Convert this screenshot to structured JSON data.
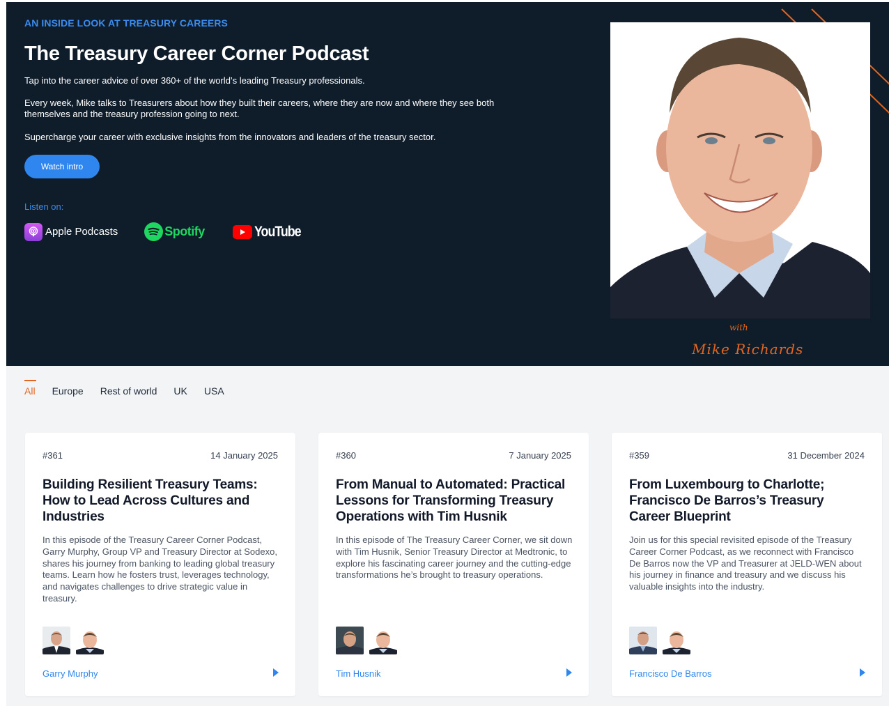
{
  "hero": {
    "eyebrow": "AN INSIDE LOOK AT TREASURY CAREERS",
    "title": "The Treasury Career Corner Podcast",
    "paragraphs": [
      "Tap into the career advice of over 360+ of the world’s leading Treasury professionals.",
      "Every week, Mike talks to Treasurers about how they built their careers, where they are now and where they see both themselves and the treasury profession going to next.",
      "Supercharge your career with exclusive insights from the innovators and leaders of the treasury sector."
    ],
    "watch_button": "Watch intro",
    "listen_label": "Listen on:",
    "platforms": [
      {
        "label": "Apple Podcasts",
        "icon": "apple-podcasts-icon"
      },
      {
        "label": "Spotify",
        "icon": "spotify-icon"
      },
      {
        "label": "YouTube",
        "icon": "youtube-icon"
      }
    ],
    "signature_with": "with",
    "signature_name": "Mike Richards"
  },
  "filters": {
    "items": [
      "All",
      "Europe",
      "Rest of world",
      "UK",
      "USA"
    ],
    "active": "All"
  },
  "episodes": [
    {
      "number": "#361",
      "date": "14 January 2025",
      "title": "Building Resilient Treasury Teams: How to Lead Across Cultures and Industries",
      "description": "In this episode of the Treasury Career Corner Podcast, Garry Murphy, Group VP and Treasury Director at Sodexo, shares his journey from banking to leading global treasury teams. Learn how he fosters trust, leverages technology, and navigates challenges to drive strategic value in treasury.",
      "guest": "Garry Murphy"
    },
    {
      "number": "#360",
      "date": "7 January 2025",
      "title": "From Manual to Automated: Practical Lessons for Transforming Treasury Operations with Tim Husnik",
      "description": "In this episode of The Treasury Career Corner, we sit down with Tim Husnik, Senior Treasury Director at Medtronic, to explore his fascinating career journey and the cutting-edge transformations he’s brought to treasury operations.",
      "guest": "Tim Husnik"
    },
    {
      "number": "#359",
      "date": "31 December 2024",
      "title": "From Luxembourg to Charlotte; Francisco De Barros’s Treasury Career Blueprint",
      "description": "Join us for this special revisited episode of the Treasury Career Corner Podcast, as we reconnect with Francisco De Barros now the VP and Treasurer at JELD-WEN about his journey in finance and treasury and we discuss his valuable insights into the industry.",
      "guest": "Francisco De Barros"
    }
  ],
  "colors": {
    "hero_bg": "#0f1d2b",
    "accent_blue": "#2f86ee",
    "accent_orange": "#e2661f",
    "spotify_green": "#1ed760"
  }
}
